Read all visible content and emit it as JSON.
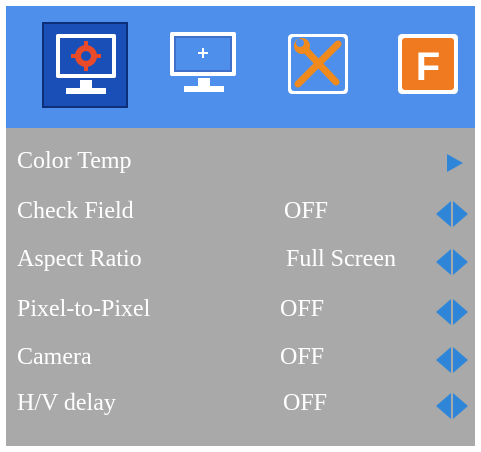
{
  "tabs": [
    {
      "id": "picture",
      "icon": "gear-monitor-icon",
      "selected": true
    },
    {
      "id": "display",
      "icon": "crosshair-monitor-icon",
      "selected": false
    },
    {
      "id": "tools",
      "icon": "wrench-screwdriver-icon",
      "selected": false
    },
    {
      "id": "function",
      "icon": "f-letter-icon",
      "selected": false,
      "glyph": "F"
    }
  ],
  "menu": {
    "items": [
      {
        "label": "Color Temp",
        "value": "",
        "control": "submenu-arrow"
      },
      {
        "label": "Check Field",
        "value": "OFF",
        "control": "left-right-arrows"
      },
      {
        "label": "Aspect Ratio",
        "value": "Full Screen",
        "control": "left-right-arrows"
      },
      {
        "label": "Pixel-to-Pixel",
        "value": "OFF",
        "control": "left-right-arrows"
      },
      {
        "label": "Camera",
        "value": "OFF",
        "control": "left-right-arrows"
      },
      {
        "label": "H/V delay",
        "value": "OFF",
        "control": "left-right-arrows"
      }
    ]
  },
  "colors": {
    "header_bg": "#4d8fea",
    "menu_bg": "#a9a9a9",
    "selected_tab": "#1b4fb8",
    "arrow": "#2f86d8",
    "text": "#ffffff"
  }
}
